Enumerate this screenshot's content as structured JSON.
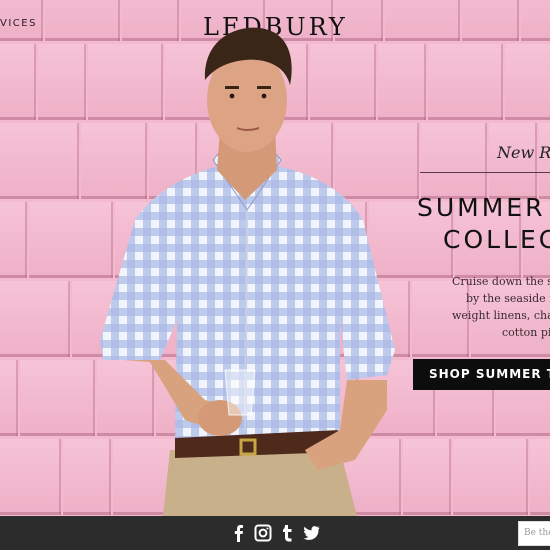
{
  "header": {
    "nav_partial": "VICES",
    "logo": "LEDBURY"
  },
  "promo": {
    "kicker": "New Rel",
    "title_line1": "SUMMER",
    "title_line2": "COLLEC",
    "description": [
      "Cruise down the sho",
      "by the seaside in c",
      "weight linens, cha",
      "cotton piq"
    ],
    "button_label": "SHOP SUMMER TRAV"
  },
  "footer": {
    "social": [
      "facebook-icon",
      "instagram-icon",
      "tumblr-icon",
      "twitter-icon"
    ],
    "email_placeholder": "Be the"
  },
  "colors": {
    "background_pink": "#f3b9cf",
    "footer": "#2c2c2c",
    "button": "#0d0d0d"
  }
}
